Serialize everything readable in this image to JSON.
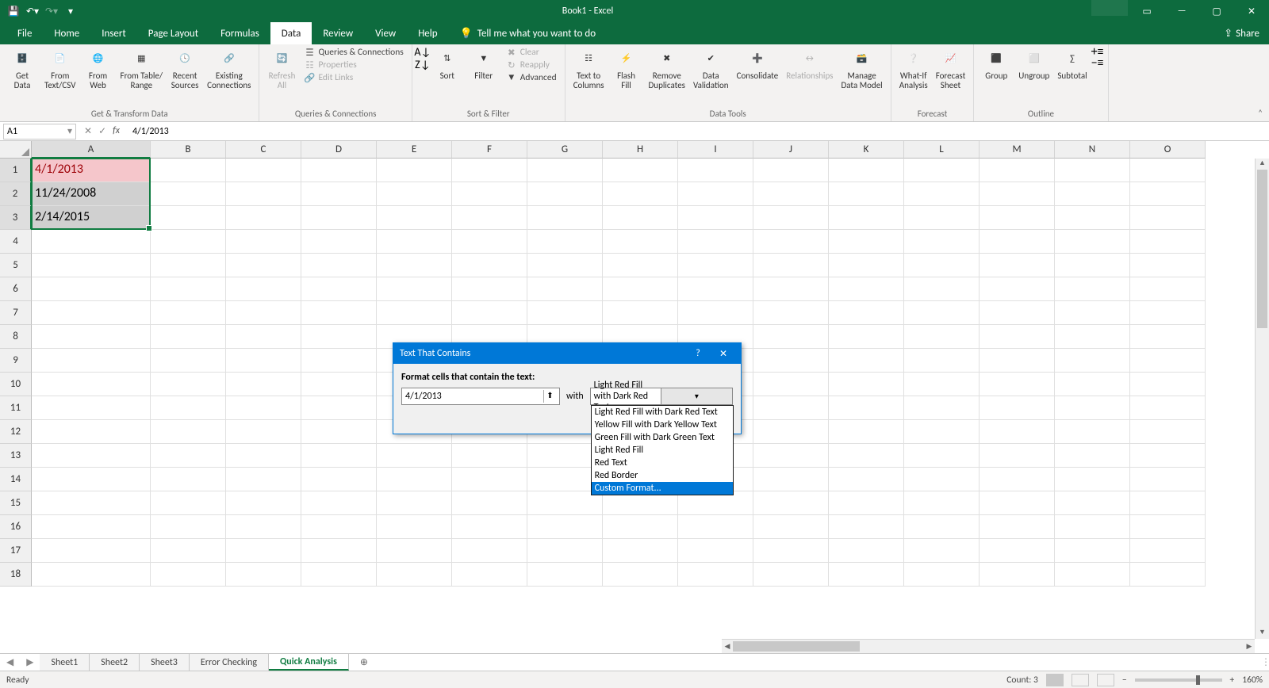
{
  "app": {
    "title": "Book1 - Excel"
  },
  "tabs": {
    "file": "File",
    "home": "Home",
    "insert": "Insert",
    "pagelayout": "Page Layout",
    "formulas": "Formulas",
    "data": "Data",
    "review": "Review",
    "view": "View",
    "help": "Help",
    "tellme": "Tell me what you want to do",
    "share": "Share"
  },
  "ribbon": {
    "group1": {
      "label": "Get & Transform Data",
      "getdata": "Get\nData",
      "fromtextcsv": "From\nText/CSV",
      "fromweb": "From\nWeb",
      "fromtable": "From Table/\nRange",
      "recent": "Recent\nSources",
      "existing": "Existing\nConnections"
    },
    "group2": {
      "label": "Queries & Connections",
      "refresh": "Refresh\nAll",
      "queries": "Queries & Connections",
      "props": "Properties",
      "editlinks": "Edit Links"
    },
    "group3": {
      "label": "Sort & Filter",
      "sort": "Sort",
      "filter": "Filter",
      "clear": "Clear",
      "reapply": "Reapply",
      "advanced": "Advanced"
    },
    "group4": {
      "label": "Data Tools",
      "texttocols": "Text to\nColumns",
      "flashfill": "Flash\nFill",
      "removedup": "Remove\nDuplicates",
      "datavalid": "Data\nValidation",
      "consolidate": "Consolidate",
      "relationships": "Relationships",
      "datamodel": "Manage\nData Model"
    },
    "group5": {
      "label": "Forecast",
      "whatif": "What-If\nAnalysis",
      "forecast": "Forecast\nSheet"
    },
    "group6": {
      "label": "Outline",
      "group": "Group",
      "ungroup": "Ungroup",
      "subtotal": "Subtotal"
    }
  },
  "formulabar": {
    "namebox": "A1",
    "value": "4/1/2013"
  },
  "columns": [
    "A",
    "B",
    "C",
    "D",
    "E",
    "F",
    "G",
    "H",
    "I",
    "J",
    "K",
    "L",
    "M",
    "N",
    "O"
  ],
  "rows": [
    1,
    2,
    3,
    4,
    5,
    6,
    7,
    8,
    9,
    10,
    11,
    12,
    13,
    14,
    15,
    16,
    17,
    18
  ],
  "cells": {
    "A1": "4/1/2013",
    "A2": "11/24/2008",
    "A3": "2/14/2015"
  },
  "sheets": {
    "s1": "Sheet1",
    "s2": "Sheet2",
    "s3": "Sheet3",
    "s4": "Error Checking",
    "s5": "Quick Analysis"
  },
  "status": {
    "ready": "Ready",
    "count": "Count: 3",
    "zoom": "160%"
  },
  "dialog": {
    "title": "Text That Contains",
    "label": "Format cells that contain the text:",
    "input": "4/1/2013",
    "with": "with",
    "selected": "Light Red Fill with Dark Red Text",
    "options": [
      "Light Red Fill with Dark Red Text",
      "Yellow Fill with Dark Yellow Text",
      "Green Fill with Dark Green Text",
      "Light Red Fill",
      "Red Text",
      "Red Border",
      "Custom Format..."
    ]
  }
}
